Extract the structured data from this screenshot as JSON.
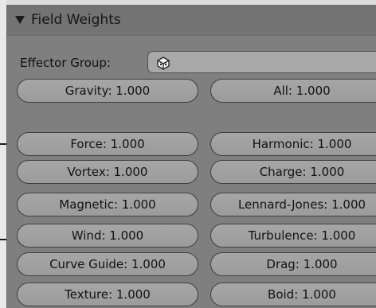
{
  "panel": {
    "title": "Field Weights",
    "effector_group": {
      "label": "Effector Group:",
      "value": ""
    },
    "buttons": [
      {
        "left": "Gravity: 1.000",
        "right": "All: 1.000"
      },
      {
        "left": "Force: 1.000",
        "right": "Harmonic: 1.000"
      },
      {
        "left": "Vortex: 1.000",
        "right": "Charge: 1.000"
      },
      {
        "left": "Magnetic: 1.000",
        "right": "Lennard-Jones: 1.000"
      },
      {
        "left": "Wind: 1.000",
        "right": "Turbulence: 1.000"
      },
      {
        "left": "Curve Guide: 1.000",
        "right": "Drag: 1.000"
      },
      {
        "left": "Texture: 1.000",
        "right": "Boid: 1.000"
      }
    ]
  },
  "icons": {
    "collapse": "disclosure-triangle-down-icon",
    "effector": "cube-group-icon"
  }
}
